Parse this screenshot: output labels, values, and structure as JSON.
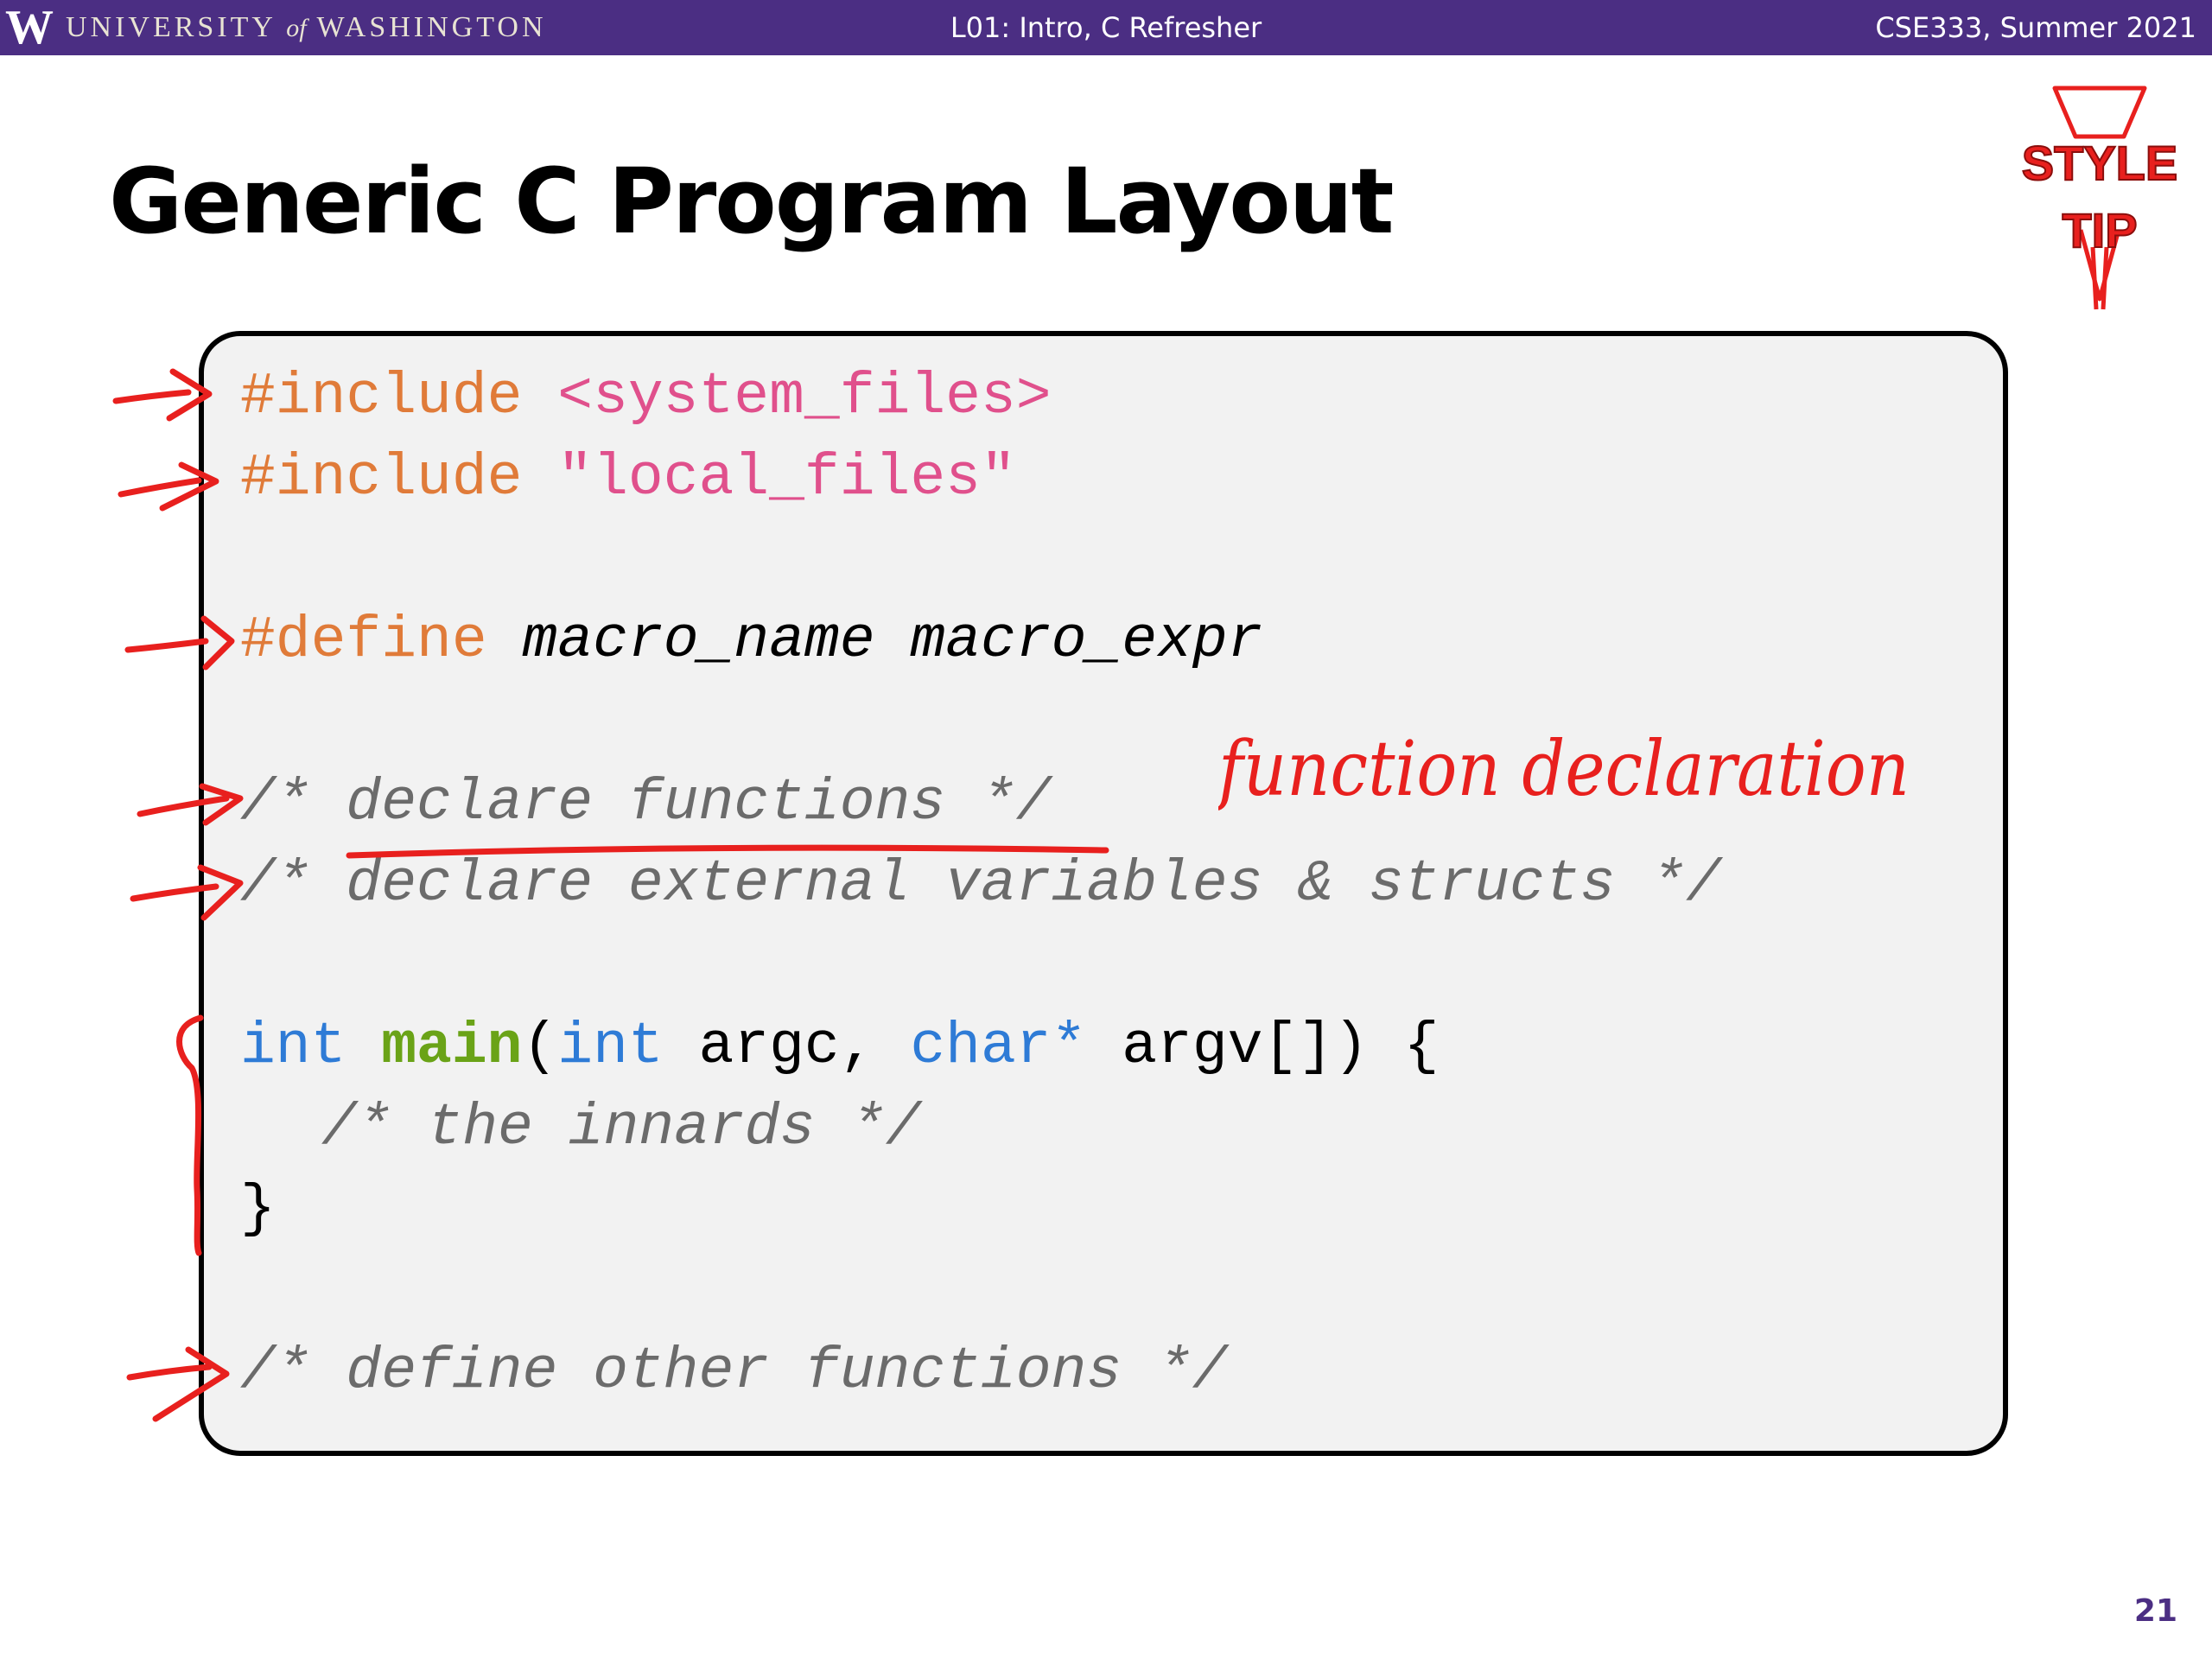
{
  "header": {
    "logo_letter": "W",
    "wordmark_left": "UNIVERSITY",
    "wordmark_of": "of",
    "wordmark_right": "WASHINGTON",
    "lecture_title": "L01:  Intro, C Refresher",
    "course": "CSE333, Summer 2021"
  },
  "slide": {
    "title": "Generic C Program Layout",
    "number": "21"
  },
  "style_tip": {
    "line1": "STYLE",
    "line2": "TIP",
    "color": "#e8201e"
  },
  "code": {
    "include_system_kw": "#include",
    "include_system_file": "<system_files>",
    "include_local_kw": "#include",
    "include_local_file": "\"local_files\"",
    "define_kw": "#define",
    "define_name": "macro_name",
    "define_expr": "macro_expr",
    "comment_declare_functions": "/* declare functions */",
    "comment_declare_external": "/* declare external variables & structs */",
    "main_ret": "int",
    "main_name": "main",
    "main_open": "(",
    "main_arg1_type": "int",
    "main_arg1": " argc, ",
    "main_arg2_type": "char*",
    "main_arg2": " argv[]) {",
    "comment_innards": "/* the innards */",
    "main_close": "}",
    "comment_define_other": "/* define other functions */"
  },
  "annotation": {
    "handwriting": "function declaration",
    "ink_color": "#e8201e"
  },
  "colors": {
    "header_purple": "#4b2e83",
    "preprocessor": "#e07b39",
    "string": "#e0508c",
    "keyword": "#2e7bd6",
    "function_name": "#6aa317",
    "comment": "#6b6b6b",
    "code_background": "#f2f2f2"
  }
}
